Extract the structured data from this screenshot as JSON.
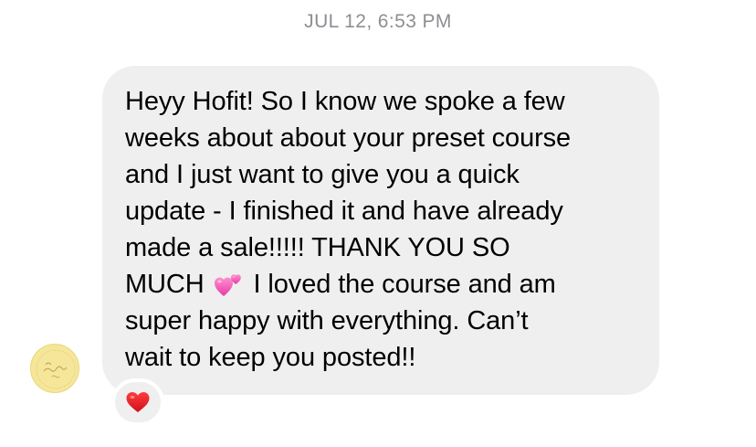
{
  "header": {
    "timestamp": "JUL 12, 6:53 PM"
  },
  "message": {
    "text_before_emoji": "Heyy Hofit! So I know we spoke a few\nweeks about about your preset course\nand I just want to give you a quick\nupdate - I finished it and have already\nmade a sale!!!!! THANK YOU SO\nMUCH ",
    "emoji": "two-hearts-icon",
    "text_after_emoji": " I loved the course and am\nsuper happy with everything. Can’t\nwait to keep you posted!!",
    "bubble_color": "#efefef"
  },
  "sender": {
    "avatar": "sender-avatar",
    "avatar_color": "#f5e69a"
  },
  "reaction": {
    "emoji": "red-heart-icon",
    "color": "#e0101b"
  }
}
